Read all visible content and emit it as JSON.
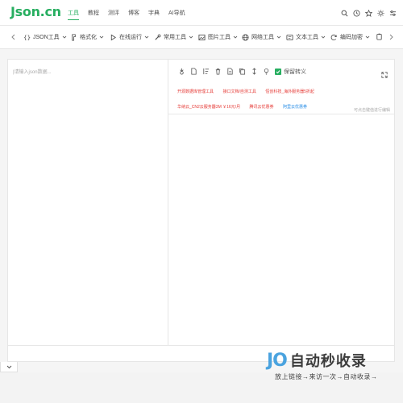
{
  "logo": "Json.cn",
  "nav": [
    "工具",
    "教程",
    "测评",
    "博客",
    "字典",
    "AI导航"
  ],
  "nav_active": 0,
  "top_icons": [
    "search-icon",
    "history-icon",
    "star-icon",
    "theme-icon",
    "settings-icon"
  ],
  "toolbar": {
    "items": [
      {
        "label": "JSON工具",
        "icon": "json-icon"
      },
      {
        "label": "格式化",
        "icon": "format-icon"
      },
      {
        "label": "在线运行",
        "icon": "play-icon"
      },
      {
        "label": "常用工具",
        "icon": "tool-icon"
      },
      {
        "label": "图片工具",
        "icon": "image-icon"
      },
      {
        "label": "网络工具",
        "icon": "globe-icon"
      },
      {
        "label": "文本工具",
        "icon": "text-icon"
      },
      {
        "label": "编码加密",
        "icon": "encode-icon"
      }
    ]
  },
  "editor": {
    "placeholder": "|请输入json数据...",
    "keep_escape_label": "保留转义",
    "right_icons": [
      "compress-icon",
      "file-icon",
      "sort-icon",
      "delete-icon",
      "document-icon",
      "copy-icon",
      "expand-collapse-icon",
      "bulb-icon"
    ],
    "ads": [
      {
        "text": "开源数据库管理工具",
        "color": "red"
      },
      {
        "text": "接口文档/自测工具",
        "color": "red"
      },
      {
        "text": "恒创科技_海外服务器5折起",
        "color": "red"
      },
      {
        "text": "华纳云_CN2云服务器3M ￥16元/月",
        "color": "red"
      },
      {
        "text": "腾讯云优惠券",
        "color": "red"
      },
      {
        "text": "阿里云优惠券",
        "color": "blue"
      }
    ],
    "hint": "可点击键值进行编辑"
  },
  "watermark": {
    "logo": "JO",
    "title": "自动秒收录",
    "subtitle": "放上链接→来访一次→自动收录→"
  },
  "colors": {
    "brand": "#27ae60",
    "ad_red": "#e53935",
    "ad_blue": "#1e88e5",
    "watermark_blue": "#4aa3df"
  }
}
